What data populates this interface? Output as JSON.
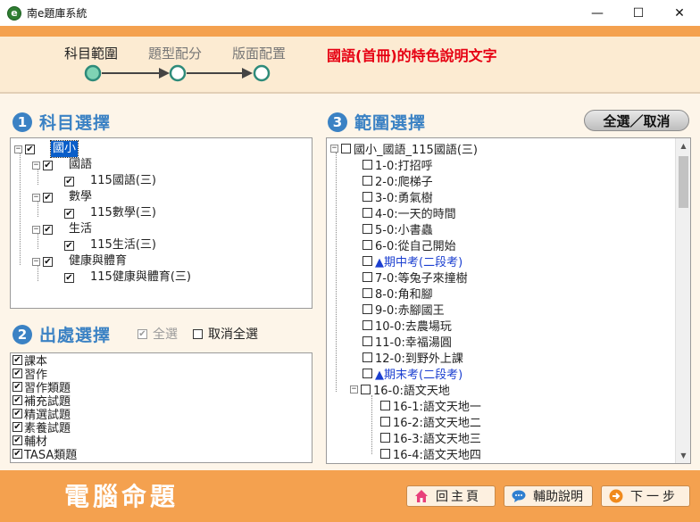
{
  "window": {
    "title": "南e題庫系統",
    "icon_letter": "e",
    "minimize": "—",
    "maximize": "☐",
    "close": "✕"
  },
  "steps": [
    {
      "label": "科目範圍"
    },
    {
      "label": "題型配分"
    },
    {
      "label": "版面配置"
    }
  ],
  "feature_text": "國語(首冊)的特色說明文字",
  "sections": {
    "subject": {
      "num": "1",
      "title": "科目選擇"
    },
    "source": {
      "num": "2",
      "title": "出處選擇"
    },
    "scope": {
      "num": "3",
      "title": "範圍選擇"
    }
  },
  "subject_tree": [
    {
      "label": "國小",
      "checked": true,
      "selected": true
    },
    {
      "label": "國語",
      "checked": true
    },
    {
      "label": "115國語(三)",
      "checked": true
    },
    {
      "label": "數學",
      "checked": true
    },
    {
      "label": "115數學(三)",
      "checked": true
    },
    {
      "label": "生活",
      "checked": true
    },
    {
      "label": "115生活(三)",
      "checked": true
    },
    {
      "label": "健康與體育",
      "checked": true
    },
    {
      "label": "115健康與體育(三)",
      "checked": true
    }
  ],
  "source_options": {
    "select_all": "全選",
    "deselect_all": "取消全選"
  },
  "source_items": [
    "課本",
    "習作",
    "習作類題",
    "補充試題",
    "精選試題",
    "素養試題",
    "輔材",
    "TASA類題"
  ],
  "scope": {
    "toggle_button": "全選／取消",
    "root": "國小_國語_115國語(三)",
    "items": [
      {
        "label": "1-0:打招呼"
      },
      {
        "label": "2-0:爬梯子"
      },
      {
        "label": "3-0:勇氣樹"
      },
      {
        "label": "4-0:一天的時間"
      },
      {
        "label": "5-0:小書蟲"
      },
      {
        "label": "6-0:從自己開始"
      },
      {
        "label": "▲期中考(二段考)",
        "exam": true
      },
      {
        "label": "7-0:等兔子來撞樹"
      },
      {
        "label": "8-0:角和腳"
      },
      {
        "label": "9-0:赤腳國王"
      },
      {
        "label": "10-0:去農場玩"
      },
      {
        "label": "11-0:幸福湯圓"
      },
      {
        "label": "12-0:到野外上課"
      },
      {
        "label": "▲期末考(二段考)",
        "exam": true
      },
      {
        "label": "16-0:語文天地",
        "parent": true
      }
    ],
    "sub_items": [
      "16-1:語文天地一",
      "16-2:語文天地二",
      "16-3:語文天地三",
      "16-4:語文天地四"
    ]
  },
  "footer": {
    "brand": "電腦命題",
    "home": "回主頁",
    "help": "輔助說明",
    "next": "下一步"
  },
  "colors": {
    "accent_orange": "#f4a14f",
    "heading_blue": "#3b82c4",
    "feature_red": "#e60012",
    "step_teal": "#2e8b7a"
  }
}
